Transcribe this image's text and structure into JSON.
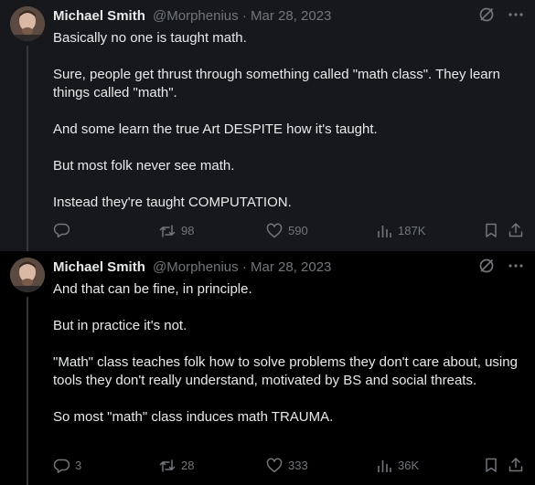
{
  "tweets": [
    {
      "author": {
        "name": "Michael Smith",
        "handle": "@Morphenius"
      },
      "separator": "·",
      "date": "Mar 28, 2023",
      "text": "Basically no one is taught math.\n\nSure, people get thrust through something called \"math class\". They learn things called \"math\".\n\nAnd some learn the true Art DESPITE how it's taught.\n\nBut most folk never see math.\n\nInstead they're taught COMPUTATION.",
      "stats": {
        "replies": "",
        "retweets": "98",
        "likes": "590",
        "views": "187K"
      }
    },
    {
      "author": {
        "name": "Michael Smith",
        "handle": "@Morphenius"
      },
      "separator": "·",
      "date": "Mar 28, 2023",
      "text": "And that can be fine, in principle.\n\nBut in practice it's not.\n\n\"Math\" class teaches folk how to solve problems they don't care about, using tools they don't really understand, motivated by BS and social threats.\n\nSo most \"math\" class induces math TRAUMA.",
      "stats": {
        "replies": "3",
        "retweets": "28",
        "likes": "333",
        "views": "36K"
      }
    }
  ],
  "icons": {
    "top": [
      "grok-icon",
      "more-icon"
    ],
    "actions": [
      "reply-icon",
      "retweet-icon",
      "like-icon",
      "views-icon",
      "bookmark-icon",
      "share-icon"
    ]
  },
  "colors": {
    "background": "#000000",
    "highlighted_background": "#16181c",
    "text": "#e7e9ea",
    "secondary_text": "#71767b",
    "thread_line": "#333639"
  }
}
